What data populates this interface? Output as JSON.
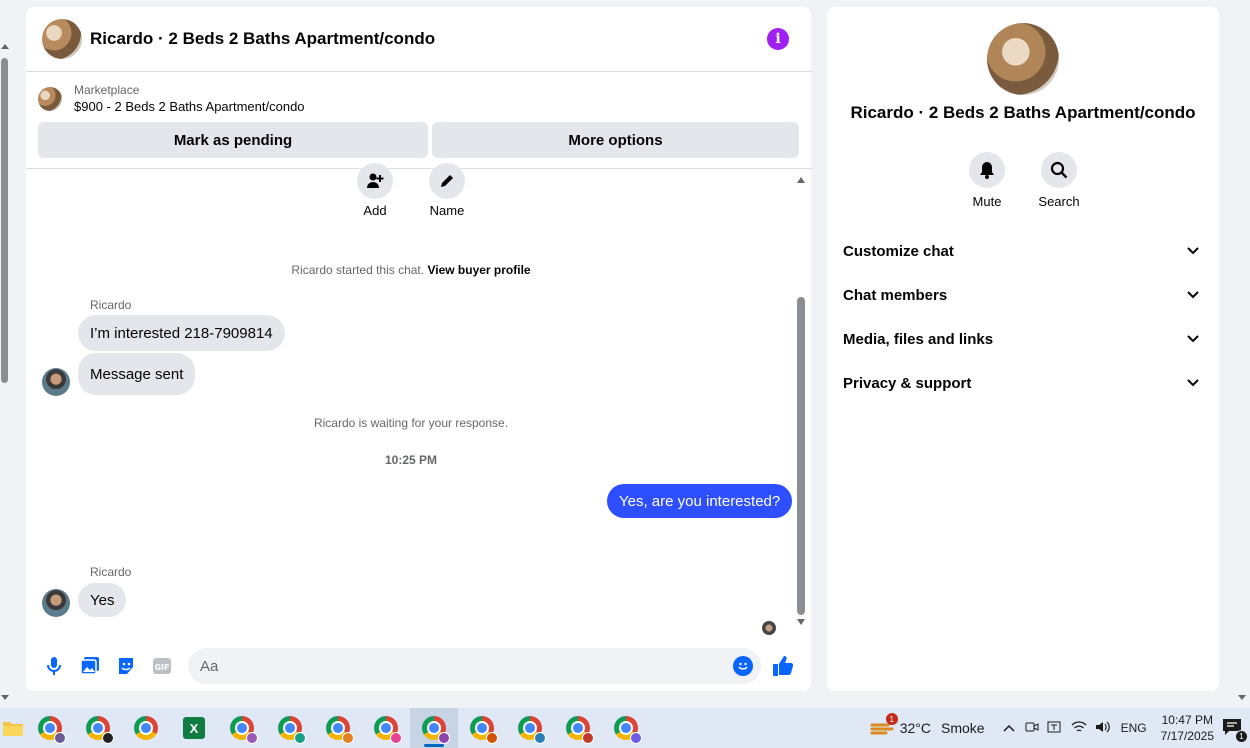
{
  "chat": {
    "title": "Ricardo · 2 Beds 2 Baths Apartment/condo",
    "listing_label": "Marketplace",
    "listing_price": "$900 - 2 Beds 2 Baths Apartment/condo",
    "mark_pending": "Mark as pending",
    "more_options": "More options",
    "actions": {
      "add": "Add",
      "name": "Name"
    },
    "started": "Ricardo started this chat.",
    "view_profile": "View buyer profile",
    "sender": "Ricardo",
    "msg1": "I’m interested 218-7909814",
    "msg2": "Message sent",
    "waiting": "Ricardo is waiting for your response.",
    "time": "10:25 PM",
    "out_msg": "Yes, are you interested?",
    "msg3": "Yes",
    "composer_placeholder": "Aa"
  },
  "info": {
    "title": "Ricardo · 2 Beds 2 Baths Apartment/condo",
    "mute": "Mute",
    "search": "Search",
    "sections": [
      "Customize chat",
      "Chat members",
      "Media, files and links",
      "Privacy & support"
    ]
  },
  "taskbar": {
    "weather_temp": "32°C",
    "weather_text": "Smoke",
    "weather_badge": "1",
    "lang": "ENG",
    "time": "10:47 PM",
    "date": "7/17/2025",
    "notif_count": "1",
    "excel_letter": "X"
  },
  "colors": {
    "accent": "#0866ff",
    "out_bubble": "#2e4fff",
    "info": "#a020f0"
  }
}
